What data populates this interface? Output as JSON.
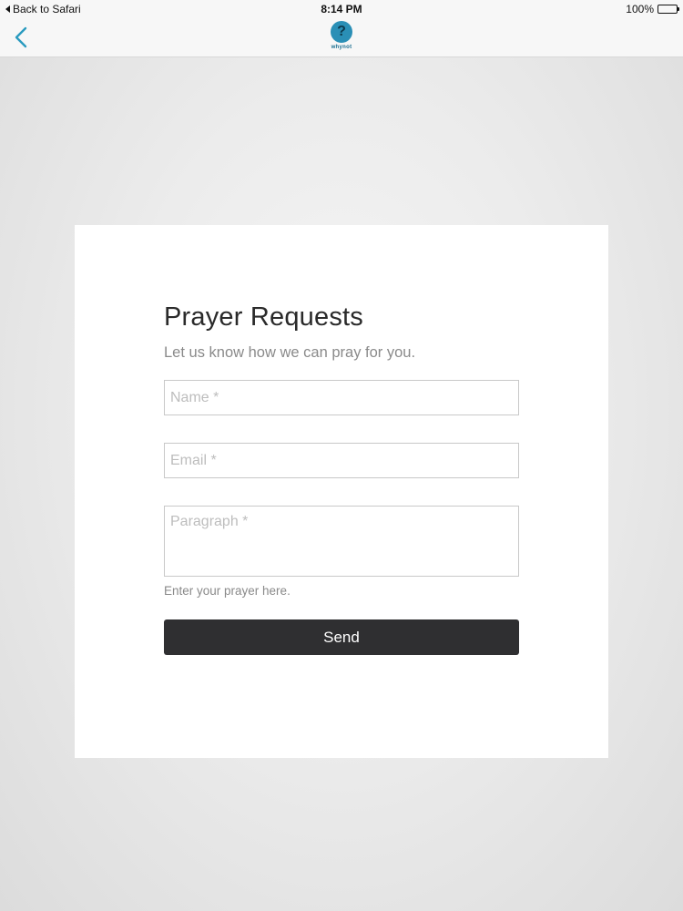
{
  "status_bar": {
    "back_label": "Back to Safari",
    "time": "8:14 PM",
    "battery": "100%",
    "battery_level": 1.0
  },
  "nav": {
    "logo_text": "whynot",
    "logo_glyph": "?",
    "back_icon": "chevron-left-icon",
    "accent_color": "#2a9bbf"
  },
  "form": {
    "title": "Prayer Requests",
    "subtitle": "Let us know how we can pray for you.",
    "name_placeholder": "Name *",
    "email_placeholder": "Email *",
    "paragraph_placeholder": "Paragraph *",
    "helper_text": "Enter your prayer here.",
    "send_label": "Send",
    "button_color": "#2f2f31"
  }
}
